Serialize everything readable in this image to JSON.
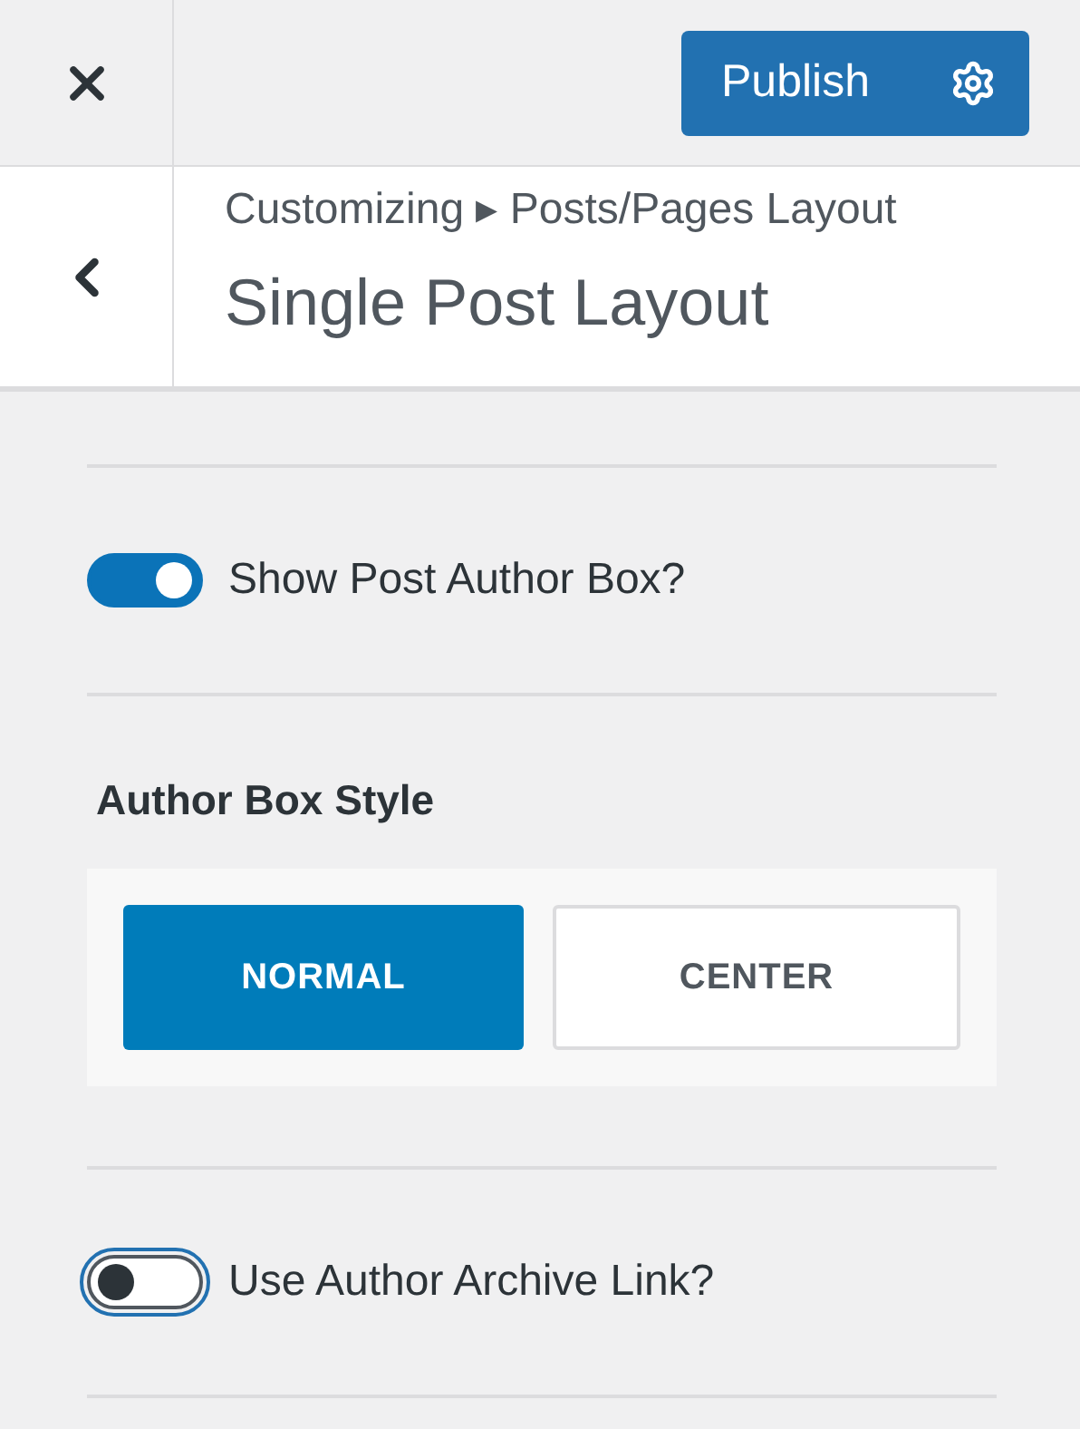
{
  "header": {
    "publish_button": "Publish"
  },
  "section": {
    "breadcrumb": "Customizing ▸ Posts/Pages Layout",
    "title": "Single Post Layout"
  },
  "controls": [
    {
      "kind": "toggle",
      "label": "Show Post Author Box?",
      "on": true,
      "focused": false
    },
    {
      "kind": "choice",
      "title": "Author Box Style",
      "options": [
        {
          "label": "NORMAL",
          "selected": true
        },
        {
          "label": "CENTER",
          "selected": false
        }
      ]
    },
    {
      "kind": "toggle",
      "label": "Use Author Archive Link?",
      "on": false,
      "focused": true
    }
  ]
}
